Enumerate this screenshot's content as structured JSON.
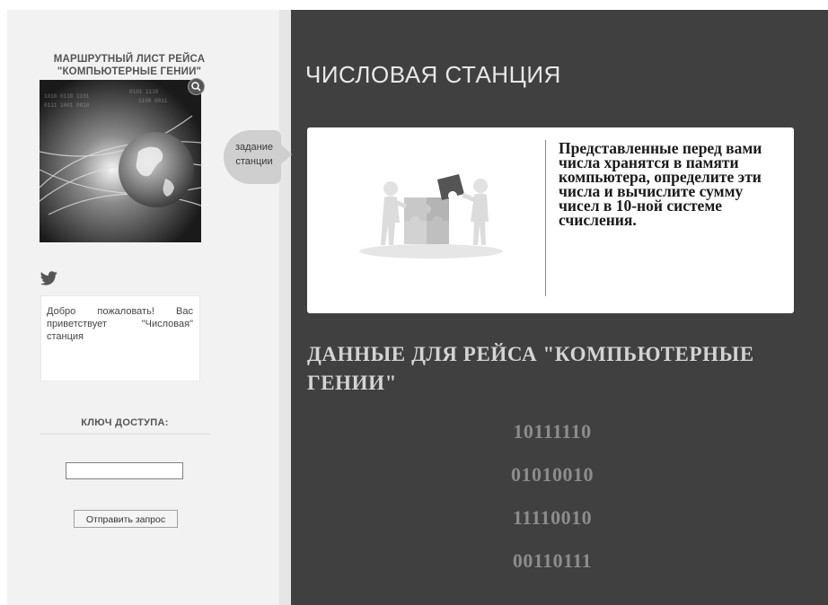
{
  "sidebar": {
    "route_title": "МАРШРУТНЫЙ ЛИСТ РЕЙСА \"КОМПЬЮТЕРНЫЕ ГЕНИИ\"",
    "hero_image_icon": "globe-network-image",
    "zoom_icon": "magnifier-icon",
    "social_icon": "twitter-bird-icon",
    "welcome_text": "Добро пожаловать! Вас приветствует \"Числовая\" станция",
    "key_label": "КЛЮЧ ДОСТУПА:",
    "key_input_value": "",
    "submit_label": "Отправить запрос"
  },
  "task_tab": {
    "label": "задание станции"
  },
  "main": {
    "station_title": "ЧИСЛОВАЯ СТАНЦИЯ",
    "task_icon": "puzzle-people-illustration",
    "task_text": "Представленные перед вами числа хранятся в памяти компьютера, определите эти числа и вычислите сумму чисел в 10-ной системе счисления.",
    "data_title": "ДАННЫЕ ДЛЯ РЕЙСА \"КОМПЬЮТЕРНЫЕ ГЕНИИ\"",
    "numbers": [
      "10111110",
      "01010010",
      "11110010",
      "00110111"
    ]
  },
  "colors": {
    "background_dark": "#404040",
    "sidebar_bg": "#f2f2f2",
    "card_bg": "#ffffff",
    "number_color": "#8c8c8c"
  }
}
